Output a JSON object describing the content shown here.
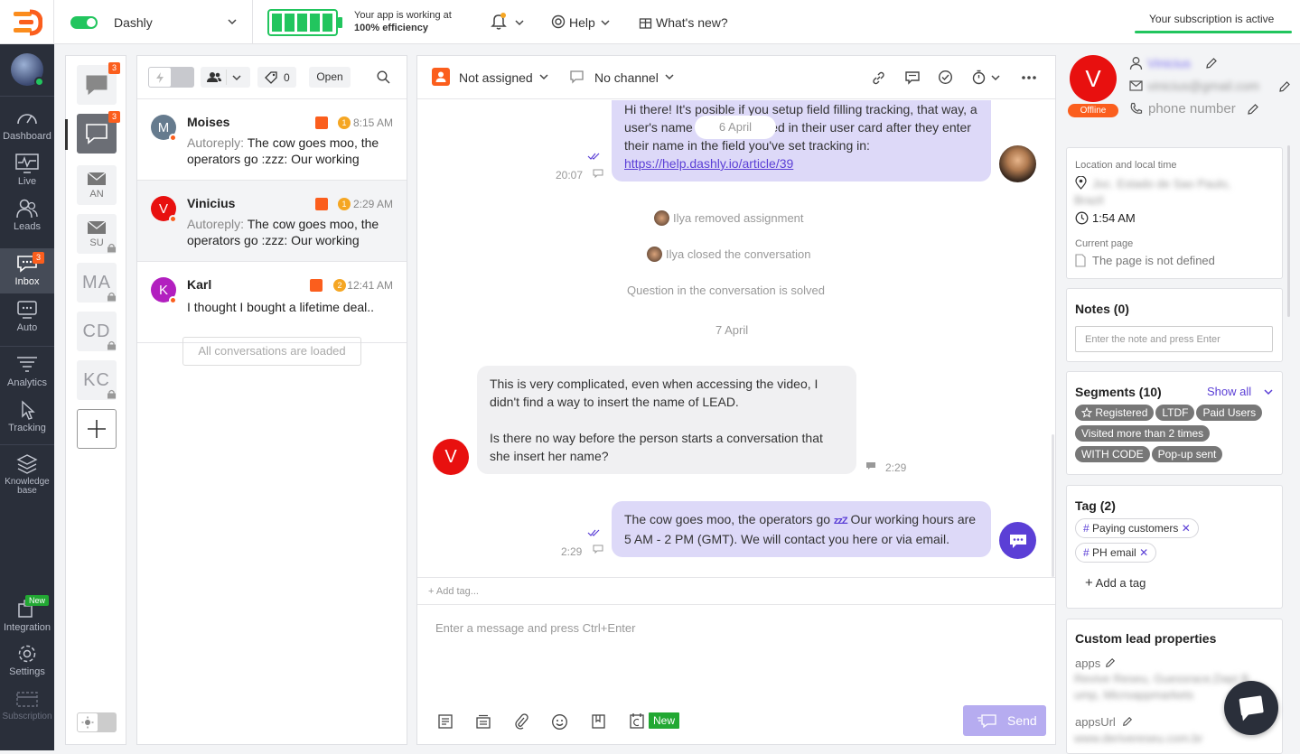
{
  "topbar": {
    "workspace": "Dashly",
    "efficiency_line1": "Your app is working at",
    "efficiency_line2": "100% efficiency",
    "help_label": "Help",
    "whats_new_label": "What's new?",
    "subscription_label": "Your subscription is active"
  },
  "rail": {
    "items": [
      {
        "label": "Dashboard",
        "icon": "speedometer-icon"
      },
      {
        "label": "Live",
        "icon": "live-chart-icon"
      },
      {
        "label": "Leads",
        "icon": "users-icon"
      },
      {
        "label": "Inbox",
        "icon": "inbox-icon",
        "badge": "3"
      },
      {
        "label": "Auto",
        "icon": "auto-message-icon"
      },
      {
        "label": "Analytics",
        "icon": "analytics-icon"
      },
      {
        "label": "Tracking",
        "icon": "cursor-icon"
      },
      {
        "label": "Knowledge base",
        "icon": "knowledge-icon"
      },
      {
        "label": "Integration",
        "icon": "integration-icon",
        "badge": "New"
      },
      {
        "label": "Settings",
        "icon": "gear-icon"
      },
      {
        "label": "Subscription",
        "icon": "card-icon"
      }
    ]
  },
  "channels": {
    "badge_all": "3",
    "badge_mine": "3",
    "an": "AN",
    "su": "SU",
    "ma": "MA",
    "cd": "CD",
    "kc": "KC"
  },
  "convlist": {
    "filter_count": "0",
    "status": "Open",
    "conversations": [
      {
        "name": "Moises",
        "initial": "M",
        "time": "8:15 AM",
        "unread": "1",
        "auto": "Autoreply:",
        "text": "The cow goes moo, the operators go :zzz: Our working",
        "color": "#667b8e"
      },
      {
        "name": "Vinicius",
        "initial": "V",
        "time": "2:29 AM",
        "unread": "1",
        "auto": "Autoreply:",
        "text": "The cow goes moo, the operators go :zzz: Our working",
        "color": "#e8100f"
      },
      {
        "name": "Karl",
        "initial": "K",
        "time": "12:41 AM",
        "unread": "2",
        "auto": "",
        "text": "I thought I bought a lifetime deal..",
        "color": "#b21fbf"
      }
    ],
    "loaded_label": "All conversations are loaded"
  },
  "chat": {
    "assignee": "Not assigned",
    "channel": "No channel",
    "msg1_text": "Hi there! It's posible if you setup field filling tracking, that way, a user's name will be recorded in their user card after they enter their name in the field you've set tracking in:",
    "msg1_link": "https://help.dashly.io/article/39",
    "msg1_time": "20:07",
    "date1": "6 April",
    "sys1": "Ilya removed assignment",
    "sys2": "Ilya closed the conversation",
    "sys3": "Question in the conversation is solved",
    "date2": "7 April",
    "msg2_p1": "This is very complicated, even when accessing the video, I didn't find a way to insert the name of LEAD.",
    "msg2_p2": "Is there no way before the person starts a conversation that she insert her name?",
    "msg2_time": "2:29",
    "msg3_a": "The cow goes moo, the operators go",
    "msg3_zzz": "zzZ",
    "msg3_b": "Our working hours are 5 AM - 2 PM (GMT). We will contact you here or via email.",
    "msg3_time": "2:29",
    "client_initial": "V",
    "add_tag": "+ Add tag...",
    "composer_placeholder": "Enter a message and press Ctrl+Enter",
    "new_badge": "New",
    "send_label": "Send"
  },
  "rightpanel": {
    "initial": "V",
    "status": "Offline",
    "name": "Vinicius",
    "email": "vinicius@gmail.com",
    "phone": "phone number",
    "location_label": "Location and local time",
    "location_value": "Joc. Estado de Sao Paulo, Brazil",
    "local_time": "1:54 AM",
    "current_page_label": "Current page",
    "current_page_value": "The page is not defined",
    "notes_title": "Notes (0)",
    "notes_placeholder": "Enter the note and press Enter",
    "segments_title": "Segments (10)",
    "show_all": "Show all",
    "segments": [
      "Registered",
      "LTDF",
      "Paid Users",
      "Visited more than 2 times",
      "WITH CODE",
      "Pop-up sent"
    ],
    "tag_title": "Tag (2)",
    "tags": [
      "Paying customers",
      "PH email"
    ],
    "add_tag": "Add a tag",
    "custom_title": "Custom lead properties",
    "prop1_label": "apps",
    "prop1_value": "Revive Reseu, Guessrace,Dapi B",
    "prop1_value2": "ump, Microappmarkets",
    "prop2_label": "appsUrl",
    "prop2_value": "www.derivereseu.com.br"
  },
  "colors": {
    "accent": "#fb5e1d",
    "operator_bubble": "#ddd9f8",
    "brand_purple": "#5b3fd6",
    "rail": "#2a2f3a",
    "green": "#22c55e"
  }
}
